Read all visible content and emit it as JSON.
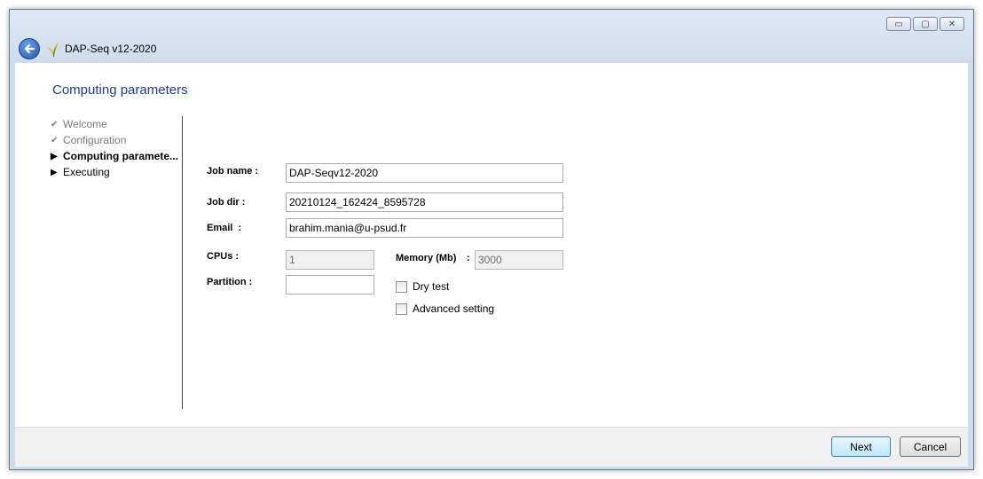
{
  "window": {
    "app_title": "DAP-Seq v12-2020",
    "controls": {
      "minimize": "▭",
      "maximize": "▢",
      "close": "✕"
    }
  },
  "page": {
    "title": "Computing parameters"
  },
  "steps": [
    {
      "label": "Welcome",
      "state": "done"
    },
    {
      "label": "Configuration",
      "state": "done"
    },
    {
      "label": "Computing paramete...",
      "state": "current"
    },
    {
      "label": "Executing",
      "state": "pending"
    }
  ],
  "form": {
    "job_name": {
      "label": "Job name :",
      "value": "DAP-Seqv12-2020"
    },
    "job_dir": {
      "label": "Job dir :",
      "value": "20210124_162424_8595728"
    },
    "email": {
      "label": "Email  :",
      "value": "brahim.mania@u-psud.fr"
    },
    "cpus": {
      "label": "CPUs :",
      "value": "1"
    },
    "memory": {
      "label": "Memory (Mb)",
      "sep": ":",
      "value": "3000"
    },
    "partition": {
      "label": "Partition :",
      "value": ""
    },
    "dry_test": {
      "label": "Dry test",
      "checked": false
    },
    "advanced": {
      "label": "Advanced setting",
      "checked": false
    }
  },
  "footer": {
    "next_label": "Next",
    "cancel_label": "Cancel"
  },
  "icons": {
    "check": "✔",
    "arrow": "▶"
  }
}
